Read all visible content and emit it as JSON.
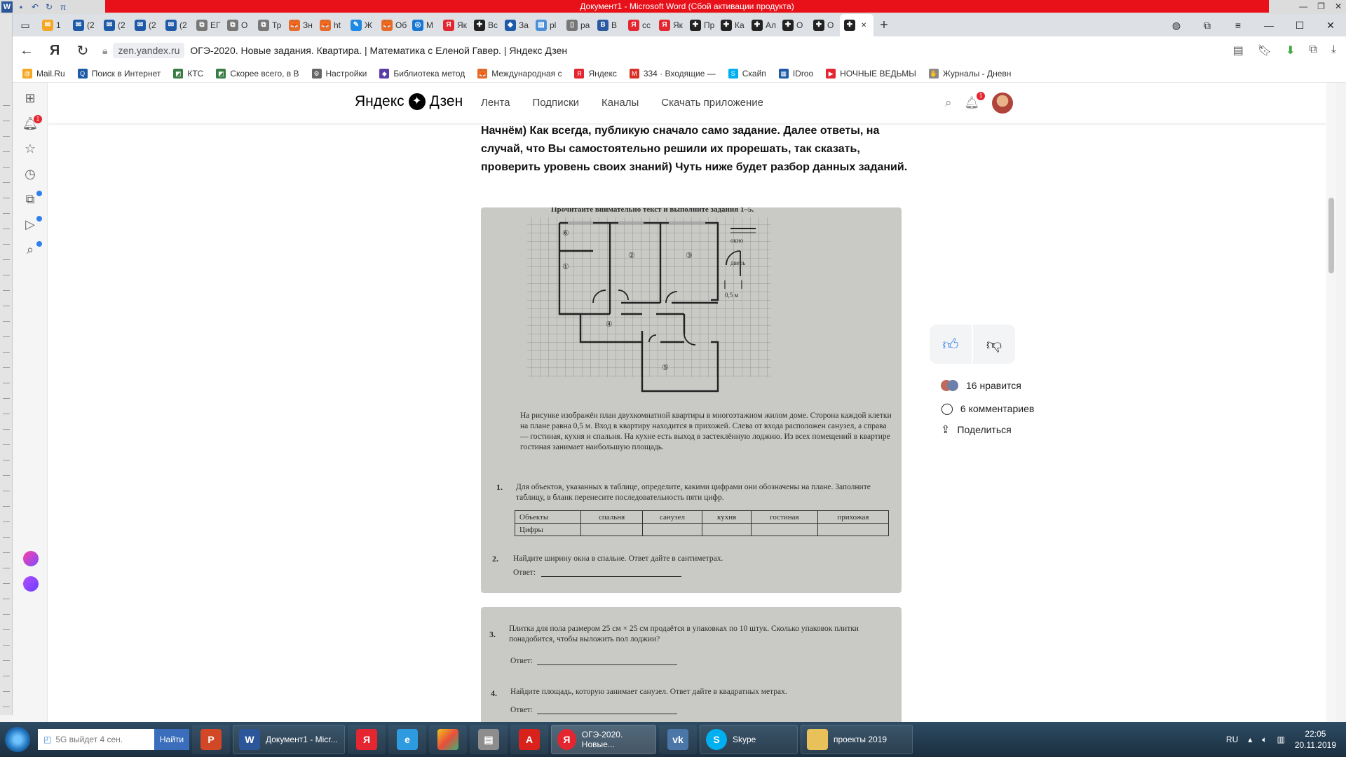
{
  "word": {
    "title": "Документ1  -  Microsoft Word (Сбой активации продукта)",
    "logo": "W"
  },
  "tabs": [
    {
      "label": "1",
      "color": "#f5a623",
      "fav": "✉"
    },
    {
      "label": "(2",
      "color": "#1e5aa8",
      "fav": "✉"
    },
    {
      "label": "(2",
      "color": "#1e5aa8",
      "fav": "✉"
    },
    {
      "label": "(2",
      "color": "#1e5aa8",
      "fav": "✉"
    },
    {
      "label": "(2",
      "color": "#1e5aa8",
      "fav": "✉"
    },
    {
      "label": "ЕГ",
      "color": "#777",
      "fav": "⧉"
    },
    {
      "label": "О",
      "color": "#777",
      "fav": "⧉"
    },
    {
      "label": "Тр",
      "color": "#777",
      "fav": "⧉"
    },
    {
      "label": "Зн",
      "color": "#e86a28",
      "fav": "🦊"
    },
    {
      "label": "ht",
      "color": "#e86a28",
      "fav": "🦊"
    },
    {
      "label": "Ж",
      "color": "#1e88e5",
      "fav": "✎"
    },
    {
      "label": "Об",
      "color": "#e86a28",
      "fav": "🦊"
    },
    {
      "label": "М",
      "color": "#1976d2",
      "fav": "◎"
    },
    {
      "label": "Як",
      "color": "#e3262f",
      "fav": "Я"
    },
    {
      "label": "Вс",
      "color": "#222",
      "fav": "✚"
    },
    {
      "label": "За",
      "color": "#1e5aa8",
      "fav": "◆"
    },
    {
      "label": "pl",
      "color": "#4a90d9",
      "fav": "▤"
    },
    {
      "label": "ра",
      "color": "#777",
      "fav": "▯"
    },
    {
      "label": "В",
      "color": "#2c5aa0",
      "fav": "В"
    },
    {
      "label": "сс",
      "color": "#e3262f",
      "fav": "Я"
    },
    {
      "label": "Як",
      "color": "#e3262f",
      "fav": "Я"
    },
    {
      "label": "Пр",
      "color": "#222",
      "fav": "✚"
    },
    {
      "label": "Ка",
      "color": "#222",
      "fav": "✚"
    },
    {
      "label": "Ал",
      "color": "#222",
      "fav": "✚"
    },
    {
      "label": "О",
      "color": "#222",
      "fav": "✚"
    },
    {
      "label": "О",
      "color": "#222",
      "fav": "✚"
    },
    {
      "label": "",
      "color": "#222",
      "fav": "✚",
      "active": true
    }
  ],
  "address": {
    "domain": "zen.yandex.ru",
    "title": "ОГЭ-2020. Новые задания. Квартира. | Математика с Еленой Гавер. | Яндекс Дзен"
  },
  "bookmarks": [
    {
      "label": "Mail.Ru",
      "color": "#f5a623",
      "icon": "@"
    },
    {
      "label": "Поиск в Интернет",
      "color": "#1e5aa8",
      "icon": "Q"
    },
    {
      "label": "КТС",
      "color": "#3a7d44",
      "icon": "◩"
    },
    {
      "label": "Скорее всего, в В",
      "color": "#3a7d44",
      "icon": "◩"
    },
    {
      "label": "Настройки",
      "color": "#666",
      "icon": "⚙"
    },
    {
      "label": "Библиотека метод",
      "color": "#5b3da8",
      "icon": "◆"
    },
    {
      "label": "Международная с",
      "color": "#e86a28",
      "icon": "🦊"
    },
    {
      "label": "Яндекс",
      "color": "#e3262f",
      "icon": "Я"
    },
    {
      "label": "334 · Входящие —",
      "color": "#d93025",
      "icon": "M"
    },
    {
      "label": "Скайп",
      "color": "#00aff0",
      "icon": "S"
    },
    {
      "label": "IDroo",
      "color": "#1e5aa8",
      "icon": "▦"
    },
    {
      "label": "НОЧНЫЕ ВЕДЬМЫ",
      "color": "#e3262f",
      "icon": "▶"
    },
    {
      "label": "Журналы - Дневн",
      "color": "#888",
      "icon": "✋"
    }
  ],
  "zen": {
    "logo_left": "Яндекс",
    "logo_right": "Дзен",
    "nav": [
      "Лента",
      "Подписки",
      "Каналы",
      "Скачать приложение"
    ],
    "notif_count": "1"
  },
  "sidebar": {
    "notif_count": "1"
  },
  "article": {
    "intro": "Начнём) Как всегда, публикую сначало само задание. Далее ответы, на случай, что Вы самостоятельно решили их прорешать, так сказать, проверить уровень своих знаний) Чуть ниже будет разбор данных заданий."
  },
  "scan1": {
    "header": "Прочитайте внимательно текст и выполните задания 1–5.",
    "rooms": [
      "⑥",
      "①",
      "②",
      "③",
      "④",
      "⑤"
    ],
    "legend_window": "окно",
    "legend_door": "дверь",
    "legend_scale": "0,5 м",
    "description": "На рисунке изображён план двухкомнатной квартиры в многоэтажном жилом доме. Сторона каждой клетки на плане равна 0,5 м. Вход в квартиру находится в прихожей. Слева от входа расположен санузел, а справа — гостиная, кухня и спальня. На кухне есть выход в застеклённую лоджию. Из всех помещений в квартире гостиная занимает наибольшую площадь.",
    "task1_num": "1.",
    "task1": "Для объектов, указанных в таблице, определите, какими цифрами они обозначены на плане. Заполните таблицу, в бланк перенесите последовательность пяти цифр.",
    "table_headers": [
      "Объекты",
      "спальня",
      "санузел",
      "кухня",
      "гостиная",
      "прихожая"
    ],
    "table_row_label": "Цифры",
    "task2_num": "2.",
    "task2": "Найдите ширину окна в спальне. Ответ дайте в сантиметрах.",
    "answer_label": "Ответ:"
  },
  "scan2": {
    "task3_num": "3.",
    "task3": "Плитка для пола размером 25 см × 25 см продаётся в упаковках по 10 штук. Сколько упаковок плитки понадобится, чтобы выложить пол лоджии?",
    "task4_num": "4.",
    "task4": "Найдите площадь, которую занимает санузел. Ответ дайте в квадратных метрах.",
    "answer_label": "Ответ:"
  },
  "reactions": {
    "likes": "16 нравится",
    "comments": "6 комментариев",
    "share": "Поделиться"
  },
  "taskbar": {
    "search_placeholder": "5G выйдет 4 сен.",
    "search_button": "Найти",
    "items": [
      {
        "label": "Документ1 - Micr...",
        "color": "#2b579a",
        "icon": "W"
      },
      {
        "label": "ОГЭ-2020. Новые...",
        "color": "#e3262f",
        "icon": "Я"
      },
      {
        "label": "Skype",
        "color": "#00aff0",
        "icon": "S"
      },
      {
        "label": "проекты 2019",
        "color": "#e8c15a",
        "icon": "▬"
      }
    ],
    "lang": "RU",
    "time": "22:05",
    "date": "20.11.2019"
  }
}
